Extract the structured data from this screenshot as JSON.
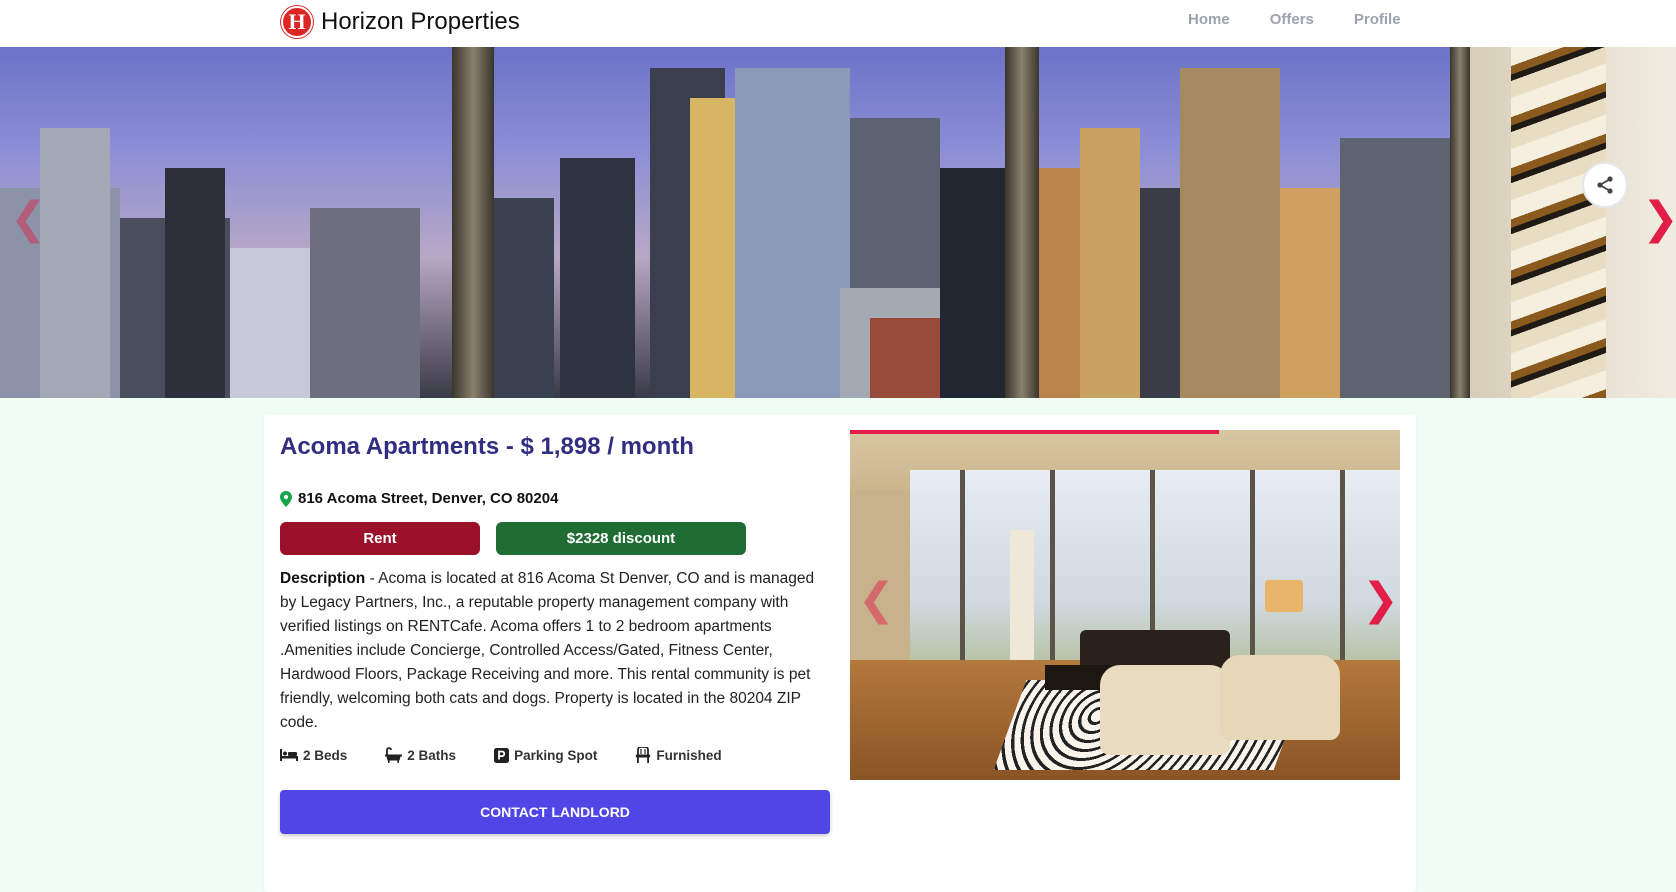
{
  "header": {
    "logo_letter": "H",
    "brand": "Horizon Properties",
    "nav": [
      "Home",
      "Offers",
      "Profile"
    ]
  },
  "hero": {
    "prev_icon": "chevron-left-icon",
    "next_icon": "chevron-right-icon",
    "share_icon": "share-icon"
  },
  "listing": {
    "title": "Acoma Apartments - $ 1,898 / month",
    "address": "816 Acoma Street, Denver, CO 80204",
    "type_tag": "Rent",
    "discount_tag": "$2328 discount",
    "description_label": "Description",
    "description_text": " - Acoma is located at 816 Acoma St Denver, CO and is managed by Legacy Partners, Inc., a reputable property management company with verified listings on RENTCafe. Acoma offers 1 to 2 bedroom apartments .Amenities include Concierge, Controlled Access/Gated, Fitness Center, Hardwood Floors, Package Receiving and more. This rental community is pet friendly, welcoming both cats and dogs. Property is located in the 80204 ZIP code.",
    "features": {
      "beds": "2 Beds",
      "baths": "2 Baths",
      "parking": "Parking Spot",
      "furnished": "Furnished"
    },
    "contact_label": "CONTACT LANDLORD"
  },
  "gallery": {
    "progress": 0.67
  },
  "colors": {
    "accent": "#e11d48",
    "rent": "#9b1129",
    "discount": "#1f6d34",
    "button": "#4f46e5",
    "title": "#312e81",
    "background": "#f0fdf4"
  }
}
